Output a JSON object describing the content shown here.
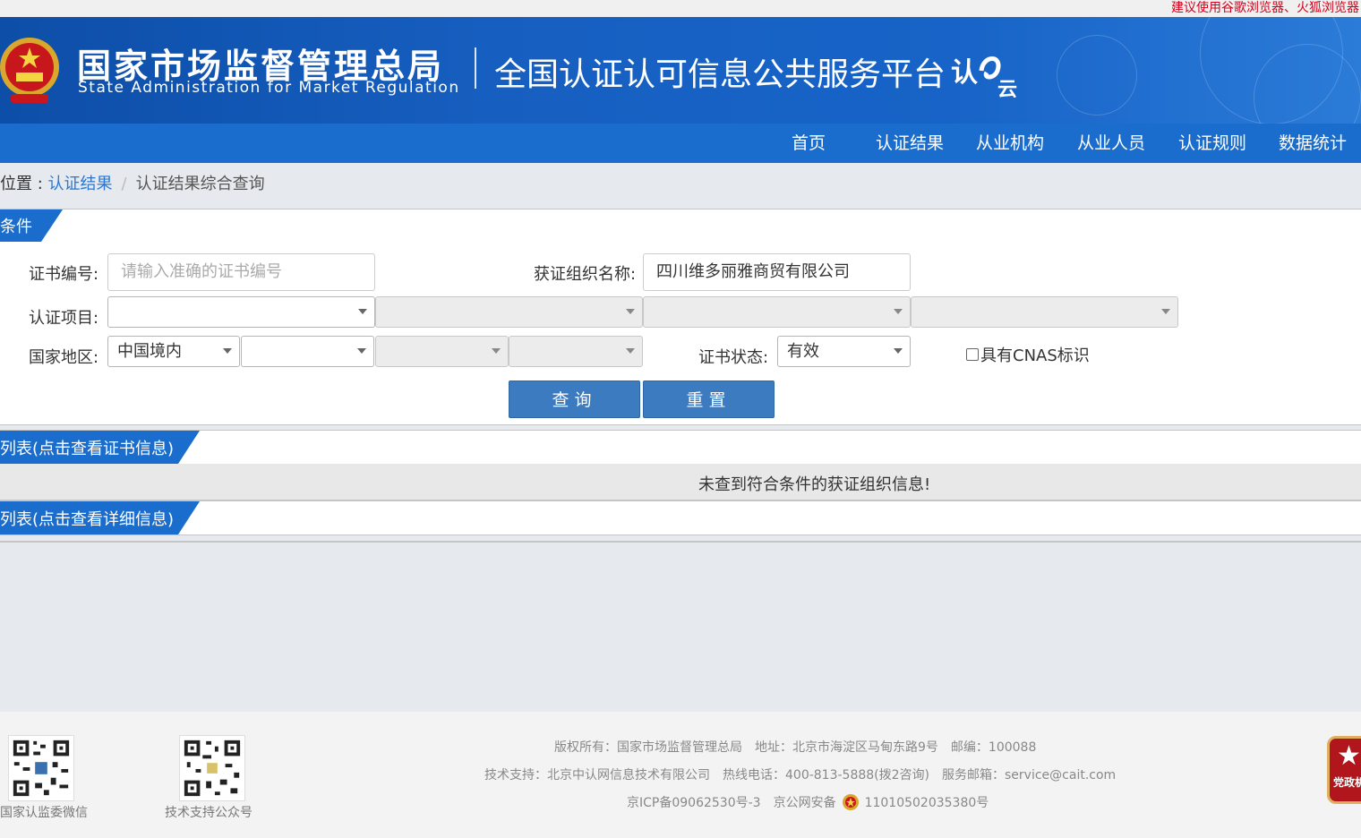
{
  "browser_tip": "建议使用谷歌浏览器、火狐浏览器",
  "header": {
    "agency_cn": "国家市场监督管理总局",
    "agency_en": "State Administration  for  Market Regulation",
    "platform_title": "全国认证认可信息公共服务平台",
    "logo_text": "认e云",
    "brand_color": "#1a6dcc"
  },
  "nav": {
    "items": [
      "首页",
      "认证结果",
      "从业机构",
      "从业人员",
      "认证规则",
      "数据统计"
    ]
  },
  "breadcrumb": {
    "prefix": "位置 : ",
    "link": "认证结果",
    "sep": "/",
    "current": "认证结果综合查询"
  },
  "sections": {
    "conditions": "条件",
    "cert_list": "列表(点击查看证书信息)",
    "detail_list": "列表(点击查看详细信息)"
  },
  "form": {
    "cert_no_label": "证书编号:",
    "cert_no_placeholder": "请输入准确的证书编号",
    "org_name_label": "获证组织名称:",
    "org_name_value": "四川维多丽雅商贸有限公司",
    "project_label": "认证项目:",
    "project_values": [
      "",
      "",
      "",
      ""
    ],
    "region_label": "国家地区:",
    "region_values": [
      "中国境内",
      "",
      "",
      ""
    ],
    "status_label": "证书状态:",
    "status_value": "有效",
    "cnas_label": "具有CNAS标识",
    "cnas_checked": false,
    "query_button": "查询",
    "reset_button": "重置"
  },
  "results": {
    "empty_message": "未查到符合条件的获证组织信息!"
  },
  "footer": {
    "qr1_label": "国家认监委微信",
    "qr2_label": "技术支持公众号",
    "line1": [
      "版权所有：国家市场监督管理总局",
      "地址：北京市海淀区马甸东路9号",
      "邮编：100088"
    ],
    "line2": [
      "技术支持：北京中认网信息技术有限公司",
      "热线电话：400-813-5888(拨2咨询)",
      "服务邮箱：service@cait.com"
    ],
    "icp": "京ICP备09062530号-3",
    "police_prefix": "京公网安备",
    "police_no": "11010502035380号",
    "badge_text": "党政机关"
  }
}
